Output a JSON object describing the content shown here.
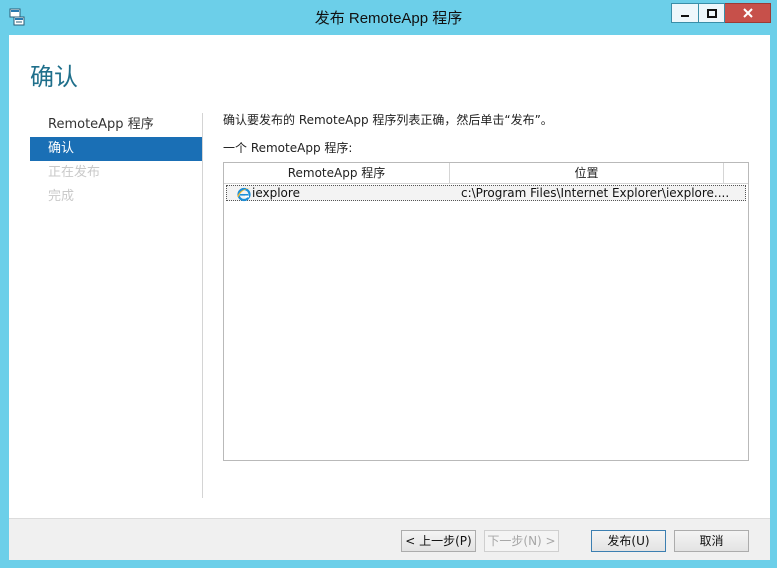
{
  "window": {
    "title": "发布 RemoteApp 程序"
  },
  "page": {
    "heading": "确认",
    "instruction": "确认要发布的 RemoteApp 程序列表正确，然后单击“发布”。",
    "list_label": "一个 RemoteApp 程序:"
  },
  "steps": [
    {
      "label": "RemoteApp 程序",
      "state": "done"
    },
    {
      "label": "确认",
      "state": "active"
    },
    {
      "label": "正在发布",
      "state": "disabled"
    },
    {
      "label": "完成",
      "state": "disabled"
    }
  ],
  "table": {
    "columns": [
      "RemoteApp 程序",
      "位置",
      ""
    ],
    "rows": [
      {
        "name": "iexplore",
        "location": "c:\\Program Files\\Internet Explorer\\iexplore...."
      }
    ]
  },
  "buttons": {
    "back": "< 上一步(P)",
    "next": "下一步(N) >",
    "publish": "发布(U)",
    "cancel": "取消"
  },
  "icons": {
    "app": "remote-app-window-icon",
    "row": "internet-explorer-icon"
  },
  "colors": {
    "frame": "#6ccfe9",
    "accent": "#1a6fb5",
    "close": "#c7504a",
    "heading": "#1f6f8b"
  }
}
